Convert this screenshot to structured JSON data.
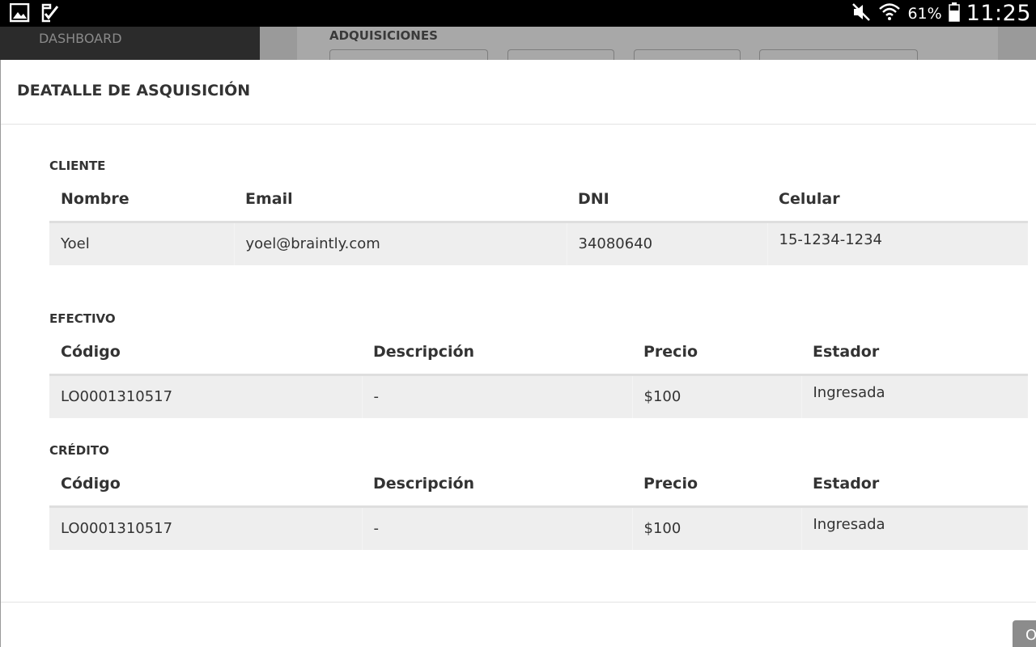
{
  "statusbar": {
    "battery_pct": "61%",
    "time": "11:25",
    "icons": [
      "gallery-icon",
      "task-check-icon",
      "mute-icon",
      "wifi-icon",
      "battery-icon"
    ]
  },
  "background": {
    "sidebar_item": "DASHBOARD",
    "panel_title": "ADQUISICIONES"
  },
  "modal": {
    "title": "DEATALLE DE ASQUISICIÓN",
    "cliente": {
      "label": "CLIENTE",
      "headers": [
        "Nombre",
        "Email",
        "DNI",
        "Celular"
      ],
      "row": [
        "Yoel",
        "yoel@braintly.com",
        "34080640",
        "15-1234-1234"
      ]
    },
    "efectivo": {
      "label": "EFECTIVO",
      "headers": [
        "Código",
        "Descripción",
        "Precio",
        "Estador"
      ],
      "row": [
        "LO0001310517",
        "-",
        "$100",
        "Ingresada"
      ]
    },
    "credito": {
      "label": "CRÉDITO",
      "headers": [
        "Código",
        "Descripción",
        "Precio",
        "Estador"
      ],
      "row": [
        "LO0001310517",
        "-",
        "$100",
        "Ingresada"
      ]
    },
    "footer_button": "O"
  },
  "colors": {
    "status_bar": "#000000",
    "table_cell_bg": "#eeeeee",
    "footer_button": "#8c8c8c"
  }
}
